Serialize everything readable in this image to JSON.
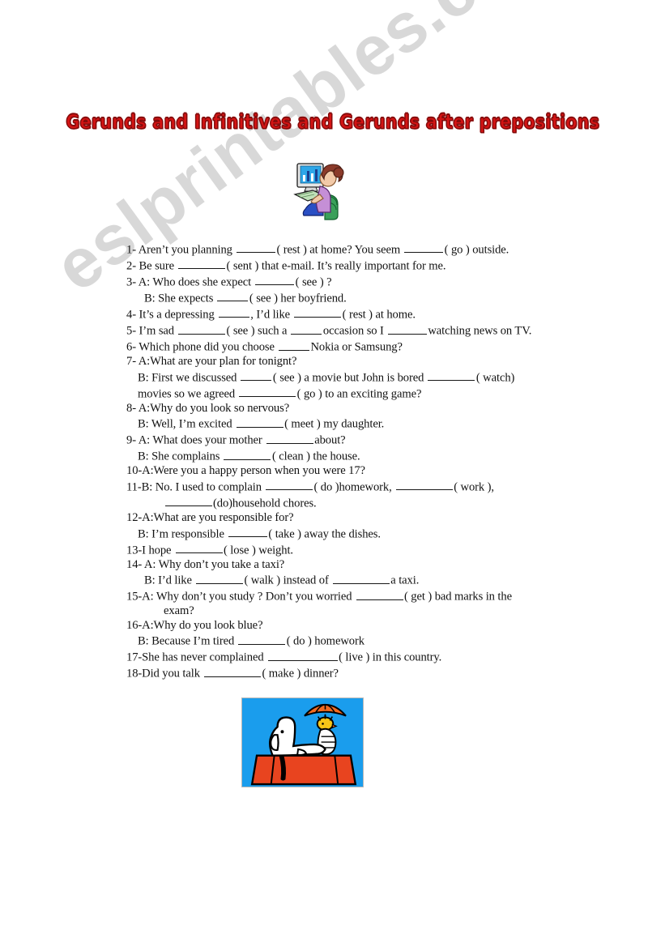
{
  "document": {
    "title": "Gerunds and Infinitives and Gerunds after prepositions",
    "watermark": "eslprintables.com"
  },
  "images": {
    "computer_clipart": {
      "name": "woman-at-computer-clipart",
      "description": "Cartoon woman with red hair sitting at a desktop computer showing a blue bar chart on screen",
      "colors": {
        "monitor_screen": "#2ea7e8",
        "monitor_body": "#e8e8e8",
        "shirt": "#c58fd6",
        "hair": "#8b3a2a",
        "skin": "#f2c9a8",
        "chair": "#3aa05a",
        "pants": "#2a4fc4",
        "keyboard": "#bfe0b8"
      }
    },
    "snoopy_clipart": {
      "name": "snoopy-on-doghouse-clipart",
      "description": "Snoopy lying on a red doghouse roof with Woodstock holding an orange umbrella, blue background",
      "colors": {
        "background": "#1a9ded",
        "doghouse": "#e8441f",
        "snoopy_body": "#ffffff",
        "outline": "#000000",
        "umbrella": "#f26a21",
        "woodstock": "#f5c518"
      }
    }
  },
  "exercise": {
    "items": [
      {
        "id": "q1",
        "lines": [
          {
            "indent": 0,
            "parts": [
              {
                "t": "text",
                "v": "1- Aren’t you planning"
              },
              {
                "t": "blank",
                "size": "b-md"
              },
              {
                "t": "text",
                "v": "( rest ) at home? You seem"
              },
              {
                "t": "blank",
                "size": "b-md"
              },
              {
                "t": "text",
                "v": "( go ) outside."
              }
            ]
          }
        ]
      },
      {
        "id": "q2",
        "lines": [
          {
            "indent": 0,
            "parts": [
              {
                "t": "text",
                "v": "2-  Be sure"
              },
              {
                "t": "blank",
                "size": "b-lg"
              },
              {
                "t": "text",
                "v": "( sent ) that e-mail. It’s really important for me."
              }
            ]
          }
        ]
      },
      {
        "id": "q3",
        "lines": [
          {
            "indent": 0,
            "parts": [
              {
                "t": "text",
                "v": "3-  A: Who does she expect"
              },
              {
                "t": "blank",
                "size": "b-md"
              },
              {
                "t": "text",
                "v": "( see ) ?"
              }
            ]
          },
          {
            "indent": 2,
            "parts": [
              {
                "t": "text",
                "v": "B: She expects"
              },
              {
                "t": "blank",
                "size": "b-sm"
              },
              {
                "t": "text",
                "v": "( see ) her boyfriend."
              }
            ]
          }
        ]
      },
      {
        "id": "q4",
        "lines": [
          {
            "indent": 0,
            "parts": [
              {
                "t": "text",
                "v": "4-  It’s a depressing"
              },
              {
                "t": "blank",
                "size": "b-sm"
              },
              {
                "t": "text",
                "v": ", I’d like"
              },
              {
                "t": "blank",
                "size": "b-lg"
              },
              {
                "t": "text",
                "v": "( rest ) at home."
              }
            ]
          }
        ]
      },
      {
        "id": "q5",
        "lines": [
          {
            "indent": 0,
            "parts": [
              {
                "t": "text",
                "v": "5-  I’m sad"
              },
              {
                "t": "blank",
                "size": "b-lg"
              },
              {
                "t": "text",
                "v": "( see ) such a"
              },
              {
                "t": "blank",
                "size": "b-sm"
              },
              {
                "t": "text",
                "v": "occasion so I"
              },
              {
                "t": "blank",
                "size": "b-md"
              },
              {
                "t": "text",
                "v": "watching news on TV."
              }
            ]
          }
        ]
      },
      {
        "id": "q6",
        "lines": [
          {
            "indent": 0,
            "parts": [
              {
                "t": "text",
                "v": "6-   Which phone did you choose"
              },
              {
                "t": "blank",
                "size": "b-sm"
              },
              {
                "t": "text",
                "v": "Nokia or Samsung?"
              }
            ]
          }
        ]
      },
      {
        "id": "q7",
        "lines": [
          {
            "indent": 0,
            "parts": [
              {
                "t": "text",
                "v": "7-  A:What are your plan for tonignt?"
              }
            ]
          },
          {
            "indent": 1,
            "parts": [
              {
                "t": "text",
                "v": "B: First we discussed"
              },
              {
                "t": "blank",
                "size": "b-sm"
              },
              {
                "t": "text",
                "v": "( see ) a movie but John is bored"
              },
              {
                "t": "blank",
                "size": "b-lg"
              },
              {
                "t": "text",
                "v": "( watch)"
              }
            ]
          },
          {
            "indent": 1,
            "parts": [
              {
                "t": "text",
                "v": "movies so we agreed"
              },
              {
                "t": "blank",
                "size": "b-xl"
              },
              {
                "t": "text",
                "v": "( go ) to an exciting game?"
              }
            ]
          }
        ]
      },
      {
        "id": "q8",
        "lines": [
          {
            "indent": 0,
            "parts": [
              {
                "t": "text",
                "v": "8-  A:Why do you look so nervous?"
              }
            ]
          },
          {
            "indent": 1,
            "parts": [
              {
                "t": "text",
                "v": "B: Well, I’m excited"
              },
              {
                "t": "blank",
                "size": "b-lg"
              },
              {
                "t": "text",
                "v": "( meet ) my daughter."
              }
            ]
          }
        ]
      },
      {
        "id": "q9",
        "lines": [
          {
            "indent": 0,
            "parts": [
              {
                "t": "text",
                "v": "9-  A: What does your mother"
              },
              {
                "t": "blank",
                "size": "b-lg"
              },
              {
                "t": "text",
                "v": "about?"
              }
            ]
          },
          {
            "indent": 1,
            "parts": [
              {
                "t": "text",
                "v": "B: She complains"
              },
              {
                "t": "blank",
                "size": "b-lg"
              },
              {
                "t": "text",
                "v": "( clean ) the house."
              }
            ]
          }
        ]
      },
      {
        "id": "q10",
        "lines": [
          {
            "indent": 0,
            "parts": [
              {
                "t": "text",
                "v": "10-A:Were you a happy person when you were 17?"
              }
            ]
          }
        ]
      },
      {
        "id": "q11",
        "lines": [
          {
            "indent": 0,
            "parts": [
              {
                "t": "text",
                "v": "11-B: No. I used to complain"
              },
              {
                "t": "blank",
                "size": "b-lg"
              },
              {
                "t": "text",
                "v": "( do )homework,"
              },
              {
                "t": "blank",
                "size": "b-xl"
              },
              {
                "t": "text",
                "v": "( work ),"
              }
            ]
          },
          {
            "indent": 3,
            "parts": [
              {
                "t": "blank",
                "size": "b-lg"
              },
              {
                "t": "text",
                "v": "(do)household chores."
              }
            ]
          }
        ]
      },
      {
        "id": "q12",
        "lines": [
          {
            "indent": 0,
            "parts": [
              {
                "t": "text",
                "v": "12-A:What are you responsible for?"
              }
            ]
          },
          {
            "indent": 1,
            "parts": [
              {
                "t": "text",
                "v": "B: I’m responsible"
              },
              {
                "t": "blank",
                "size": "b-md"
              },
              {
                "t": "text",
                "v": "( take ) away the dishes."
              }
            ]
          }
        ]
      },
      {
        "id": "q13",
        "lines": [
          {
            "indent": 0,
            "parts": [
              {
                "t": "text",
                "v": "13-I hope"
              },
              {
                "t": "blank",
                "size": "b-lg"
              },
              {
                "t": "text",
                "v": "( lose ) weight."
              }
            ]
          }
        ]
      },
      {
        "id": "q14",
        "lines": [
          {
            "indent": 0,
            "parts": [
              {
                "t": "text",
                "v": "14-  A: Why don’t you take a taxi?"
              }
            ]
          },
          {
            "indent": 2,
            "parts": [
              {
                "t": "text",
                "v": "B: I’d like"
              },
              {
                "t": "blank",
                "size": "b-lg"
              },
              {
                "t": "text",
                "v": "( walk ) instead of"
              },
              {
                "t": "blank",
                "size": "b-xl"
              },
              {
                "t": "text",
                "v": "a taxi."
              }
            ]
          }
        ]
      },
      {
        "id": "q15",
        "lines": [
          {
            "indent": 0,
            "parts": [
              {
                "t": "text",
                "v": "15-A: Why don’t you study ? Don’t you worried"
              },
              {
                "t": "blank",
                "size": "b-lg"
              },
              {
                "t": "text",
                "v": "( get ) bad marks in the"
              }
            ]
          },
          {
            "indent": 3,
            "parts": [
              {
                "t": "text",
                "v": "exam?"
              }
            ]
          }
        ]
      },
      {
        "id": "q16",
        "lines": [
          {
            "indent": 0,
            "parts": [
              {
                "t": "text",
                "v": "16-A:Why do you look blue?"
              }
            ]
          },
          {
            "indent": 1,
            "parts": [
              {
                "t": "text",
                "v": "B: Because I’m tired"
              },
              {
                "t": "blank",
                "size": "b-lg"
              },
              {
                "t": "text",
                "v": "( do ) homework"
              }
            ]
          }
        ]
      },
      {
        "id": "q17",
        "lines": [
          {
            "indent": 0,
            "parts": [
              {
                "t": "text",
                "v": "17-She has never complained"
              },
              {
                "t": "blank",
                "size": "b-xxl"
              },
              {
                "t": "text",
                "v": "( live ) in this country."
              }
            ]
          }
        ]
      },
      {
        "id": "q18",
        "lines": [
          {
            "indent": 0,
            "parts": [
              {
                "t": "text",
                "v": "18-Did you talk"
              },
              {
                "t": "blank",
                "size": "b-xl"
              },
              {
                "t": "text",
                "v": "( make ) dinner?"
              }
            ]
          }
        ]
      }
    ]
  }
}
